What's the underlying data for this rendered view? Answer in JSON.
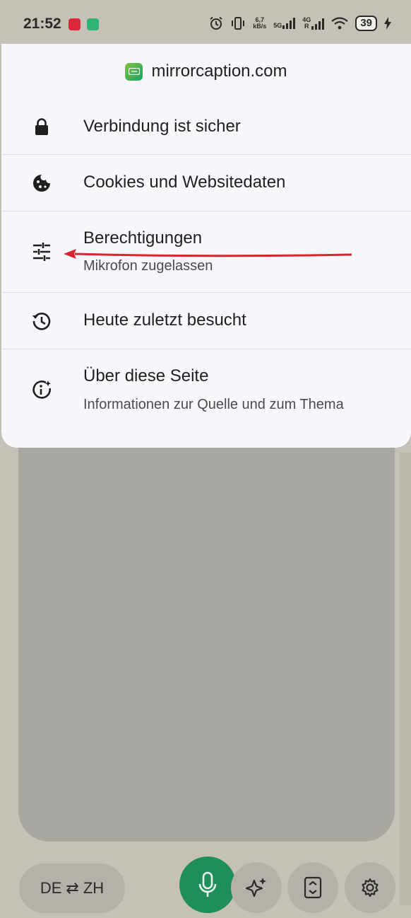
{
  "status_bar": {
    "time": "21:52",
    "net_speed_value": "6,7",
    "net_speed_unit": "kB/s",
    "sim1": "5G",
    "sim2_top": "4G",
    "sim2_bottom": "R",
    "battery": "39",
    "icons": [
      "alarm-icon",
      "vibrate-icon",
      "wifi-icon",
      "charging-icon"
    ]
  },
  "site_info": {
    "domain": "mirrorcaption.com",
    "items": [
      {
        "title": "Verbindung ist sicher",
        "subtitle": "",
        "icon": "lock-icon"
      },
      {
        "title": "Cookies und Websitedaten",
        "subtitle": "",
        "icon": "cookie-icon"
      },
      {
        "title": "Berechtigungen",
        "subtitle": "Mikrofon zugelassen",
        "icon": "tune-icon"
      },
      {
        "title": "Heute zuletzt besucht",
        "subtitle": "",
        "icon": "history-icon"
      },
      {
        "title": "Über diese Seite",
        "subtitle": "Informationen zur Quelle und zum Thema",
        "icon": "info-sparkle-icon"
      }
    ]
  },
  "bottom_bar": {
    "lang_from": "DE",
    "lang_swap": "⇄",
    "lang_to": "ZH"
  },
  "colors": {
    "sheet_bg": "#f8f7fc",
    "mic_button": "#1e8f5a",
    "annotation_arrow": "#d9252e"
  }
}
